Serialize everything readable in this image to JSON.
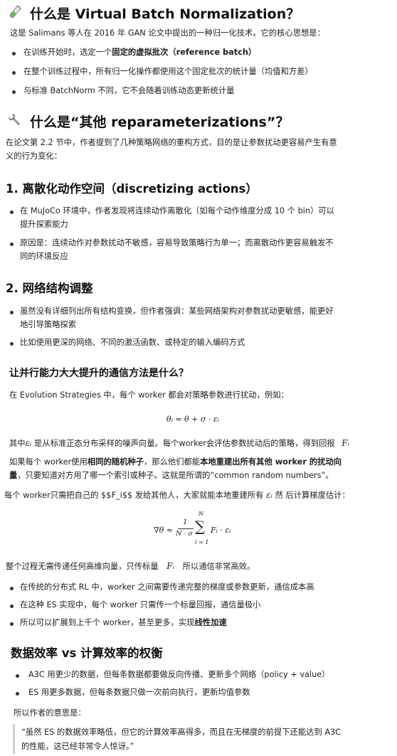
{
  "section1": {
    "icon": "test-tube-icon",
    "title": "什么是 Virtual Batch Normalization？",
    "intro": "这是 Salimans 等人在 2016 年 GAN 论文中提出的一种归一化技术。它的核心思想是：",
    "bullets": [
      {
        "pre": "在训练开始时，选定一个",
        "bold": "固定的虚拟批次（reference batch）",
        "post": ""
      },
      {
        "pre": "在整个训练过程中，所有归一化操作都使用这个固定批次的统计量（均值和方差）",
        "bold": "",
        "post": ""
      },
      {
        "pre": "与标准 BatchNorm 不同，它不会随着训练动态更新统计量",
        "bold": "",
        "post": ""
      }
    ]
  },
  "section2": {
    "icon": "wrench-icon",
    "title": "什么是“其他 reparameterizations”？",
    "intro_line1": "在论文第 2.2 节中，作者提到了几种策略网络的重构方式，目的是让参数扰动更容易产生有意",
    "intro_line2": "义的行为变化：",
    "sub1": {
      "title": "1. 离散化动作空间（discretizing actions）",
      "bullets": [
        [
          "在 MuJoCo 环境中，作者发现将连续动作离散化（如每个动作维度分成 10 个 bin）可以",
          "提升探索能力"
        ],
        [
          "原因是：连续动作对参数扰动不敏感，容易导致策略行为单一；而离散动作更容易触发不",
          "同的环境反应"
        ]
      ]
    },
    "sub2": {
      "title": "2. 网络结构调整",
      "bullets": [
        [
          "虽然没有详细列出所有结构变换，但作者强调：某些网络架构对参数扰动更敏感，能更好",
          "地引导策略探索"
        ],
        [
          "比如使用更深的网络、不同的激活函数、或特定的输入编码方式"
        ]
      ]
    }
  },
  "section3": {
    "title": "让并行能力大大提升的通信方法是什么？",
    "line1": "在 Evolution Strategies 中，每个 worker 都会对策略参数进行扰动，例如：",
    "eq1": "θᵢ = θ + σ · εᵢ",
    "line2_pre": "其中",
    "line2_eps": "εᵢ",
    "line2_post": " 是从标准正态分布采样的噪声向量。每个worker会评估参数扰动后的策略，得到回报",
    "line2_F": "Fᵢ",
    "line3_pre": "如果每个 worker使用",
    "line3_b1": "相同的随机种子",
    "line3_mid": "，那么他们都能",
    "line3_b2": "本地重建出所有其他 worker 的扰动向",
    "line4_b": "量",
    "line4_post": "，只要知道对方用了哪一个索引或种子。这就是所谓的“common random numbers”。",
    "line5_pre": "每个 worker只需把自己的 $$F_i$$ 发给其他人，大家就能本地重建所有",
    "line5_eps": "εᵢ",
    "line5_post": "然 后计算梯度估计：",
    "eq2_lhs": "∇θ ≈",
    "eq2_num": "1",
    "eq2_den": "N · σ",
    "eq2_sum": "∑",
    "eq2_top": "N",
    "eq2_bot": "i = 1",
    "eq2_rhs": "Fᵢ · εᵢ",
    "line6_pre": "整个过程无需传递任何高维向量，只传标量",
    "line6_F": "Fᵢ",
    "line6_post": "所以通信非常高效。",
    "bullets": [
      {
        "pre": "在传统的分布式 RL 中，worker 之间需要传递完整的梯度或参数更新，通信成本高",
        "bold": ""
      },
      {
        "pre": "在这种 ES 实现中，每个 worker 只需传一个标量回报，通信量极小",
        "bold": ""
      },
      {
        "pre": "所以可以扩展到上千个 worker，甚至更多，实现",
        "bold": "线性加速"
      }
    ]
  },
  "section4": {
    "title": "数据效率 vs 计算效率的权衡",
    "bullets": [
      "A3C 用更少的数据，但每条数据都要做反向传播、更新多个网络（policy + value）",
      "ES 用更多数据，但每条数据只做一次前向执行，更新均值参数"
    ],
    "conclusion": "所以作者的意思是：",
    "quote_line1": "“虽然 ES 的数据效率略低，但它的计算效率高得多，而且在无梯度的前提下还能达到 A3C",
    "quote_line2": "的性能，这已经非常令人惊讶。”"
  }
}
